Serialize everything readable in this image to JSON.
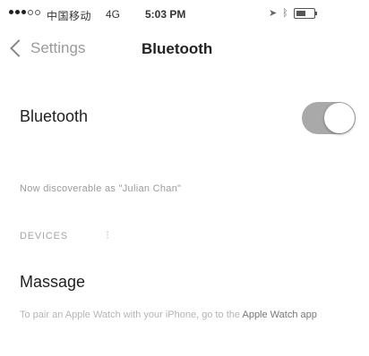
{
  "status_bar": {
    "carrier": "中国移动",
    "network": "4G",
    "time": "5:03 PM"
  },
  "nav": {
    "back_label": "Settings",
    "title": "Bluetooth"
  },
  "bluetooth": {
    "label": "Bluetooth",
    "enabled": true,
    "discoverable_text": "Now discoverable as \"Julian Chan\""
  },
  "devices": {
    "header": "DEVICES",
    "items": [
      {
        "name": "Massage"
      }
    ]
  },
  "footer": {
    "text": "To pair an Apple Watch with your iPhone, go to the",
    "app_link": "Apple Watch app"
  }
}
